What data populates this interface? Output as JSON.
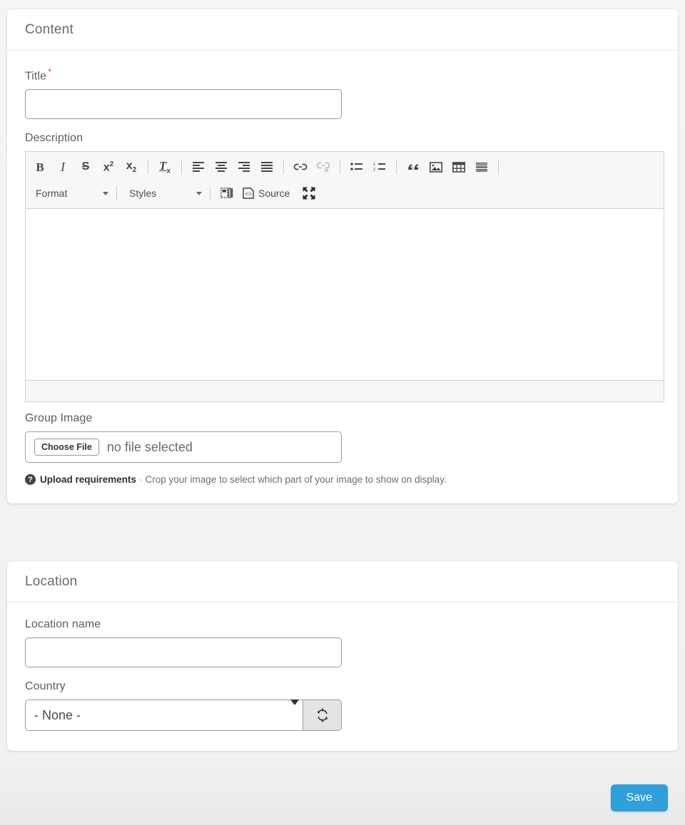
{
  "content_section": {
    "title": "Content",
    "fields": {
      "title": {
        "label": "Title",
        "required_marker": "*",
        "value": "",
        "placeholder": ""
      },
      "description": {
        "label": "Description",
        "value": ""
      },
      "group_image": {
        "label": "Group Image",
        "choose_button": "Choose File",
        "status": "no file selected",
        "hint_link": "Upload requirements",
        "hint_separator": "·",
        "hint_text": "Crop your image to select which part of your image to show on display.",
        "help_icon_glyph": "?"
      }
    },
    "editor": {
      "toolbar_row1": [
        {
          "name": "bold",
          "label": "B"
        },
        {
          "name": "italic",
          "label": "I"
        },
        {
          "name": "strikethrough",
          "label": "S"
        },
        {
          "name": "superscript",
          "label": "x"
        },
        {
          "name": "subscript",
          "label": "x"
        },
        {
          "name": "remove-format",
          "label": "T"
        },
        {
          "name": "align-left",
          "label": ""
        },
        {
          "name": "align-center",
          "label": ""
        },
        {
          "name": "align-right",
          "label": ""
        },
        {
          "name": "align-justify",
          "label": ""
        },
        {
          "name": "link",
          "label": ""
        },
        {
          "name": "unlink",
          "label": ""
        },
        {
          "name": "bulleted-list",
          "label": ""
        },
        {
          "name": "numbered-list",
          "label": ""
        },
        {
          "name": "blockquote",
          "label": ""
        },
        {
          "name": "image",
          "label": ""
        },
        {
          "name": "table",
          "label": ""
        },
        {
          "name": "horizontal-rule",
          "label": ""
        }
      ],
      "format_dropdown": "Format",
      "styles_dropdown": "Styles",
      "source_button": "Source",
      "superscript_exponent": "2",
      "subscript_index": "2",
      "remove_format_x": "x",
      "body_value": ""
    }
  },
  "location_section": {
    "title": "Location",
    "fields": {
      "location_name": {
        "label": "Location name",
        "value": "",
        "placeholder": ""
      },
      "country": {
        "label": "Country",
        "selected": "- None -",
        "options": [
          "- None -"
        ]
      }
    }
  },
  "footer": {
    "save_label": "Save"
  },
  "colors": {
    "accent": "#2fa0d8",
    "required": "#e8503a",
    "page_background": "#f3f3f4",
    "card_background": "#ffffff",
    "toolbar_background": "#f7f7f7"
  }
}
